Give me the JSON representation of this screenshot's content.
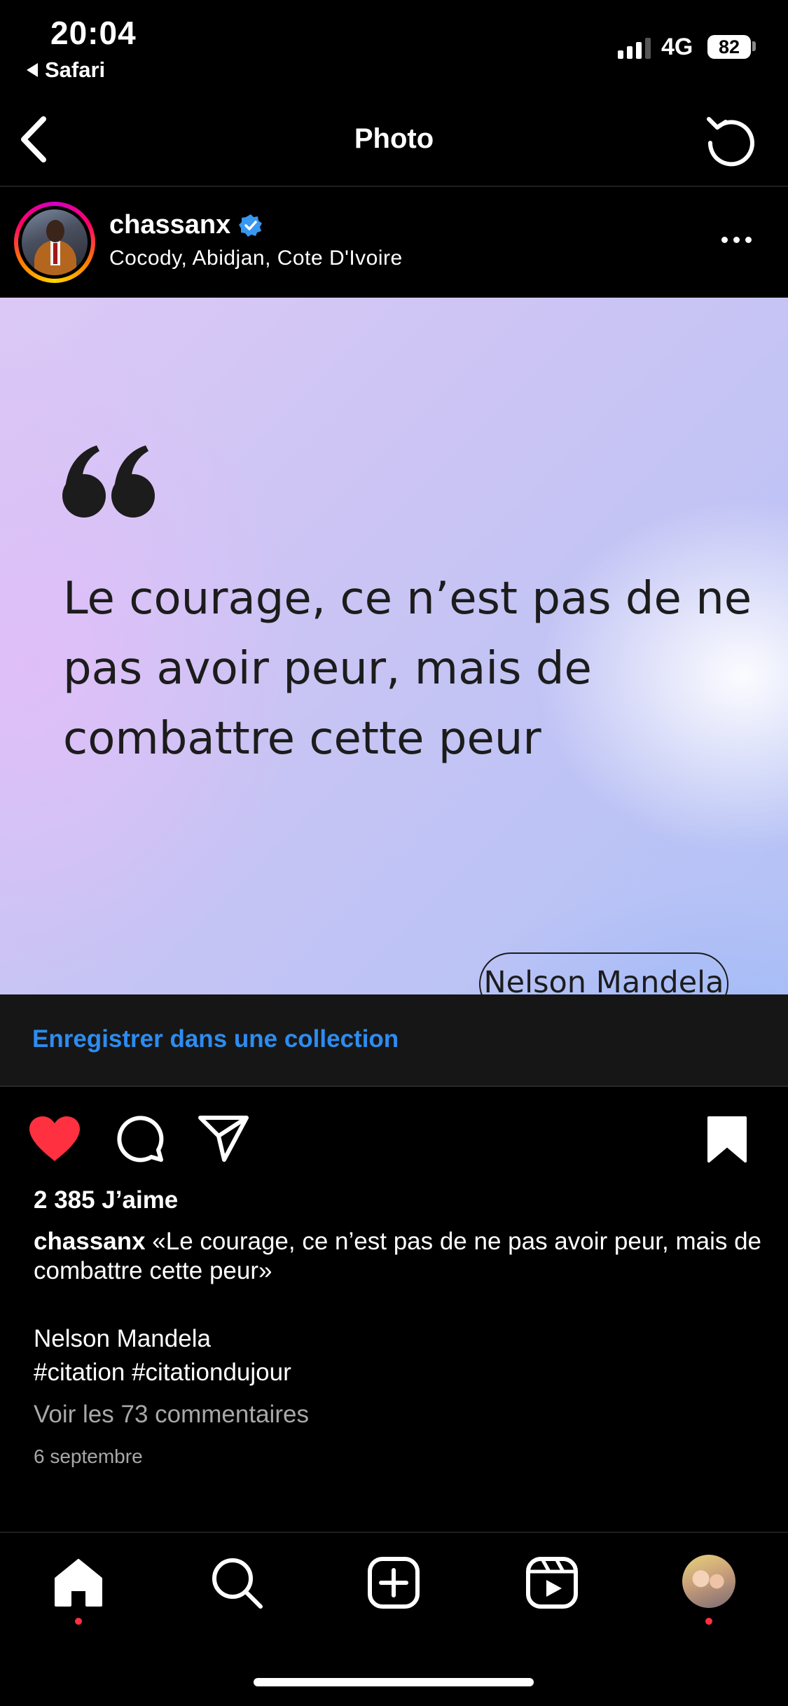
{
  "status_bar": {
    "time": "20:04",
    "back_app": "Safari",
    "network": "4G",
    "battery": "82"
  },
  "nav": {
    "title": "Photo"
  },
  "post": {
    "username": "chassanx",
    "location": "Cocody, Abidjan, Cote D'Ivoire",
    "verified": true,
    "image": {
      "quote": "Le courage, ce n’est pas de ne pas avoir peur, mais de combattre cette peur",
      "author": "Nelson Mandela"
    },
    "save_to_collection": "Enregistrer dans une collection",
    "likes": "2 385 J’aime",
    "caption_user": "chassanx",
    "caption_text": "«Le courage, ce n’est pas de ne pas avoir peur, mais de combattre cette peur»",
    "caption_author": "Nelson Mandela",
    "hashtags": "#citation #citationdujour",
    "view_comments": "Voir les 73 commentaires",
    "date": "6 septembre",
    "liked": true,
    "saved": true
  },
  "colors": {
    "like": "#ff3040",
    "link": "#2d8cf0",
    "verified": "#3897f0"
  },
  "tab_bar": [
    "home-icon",
    "search-icon",
    "create-icon",
    "reels-icon",
    "profile-avatar"
  ]
}
